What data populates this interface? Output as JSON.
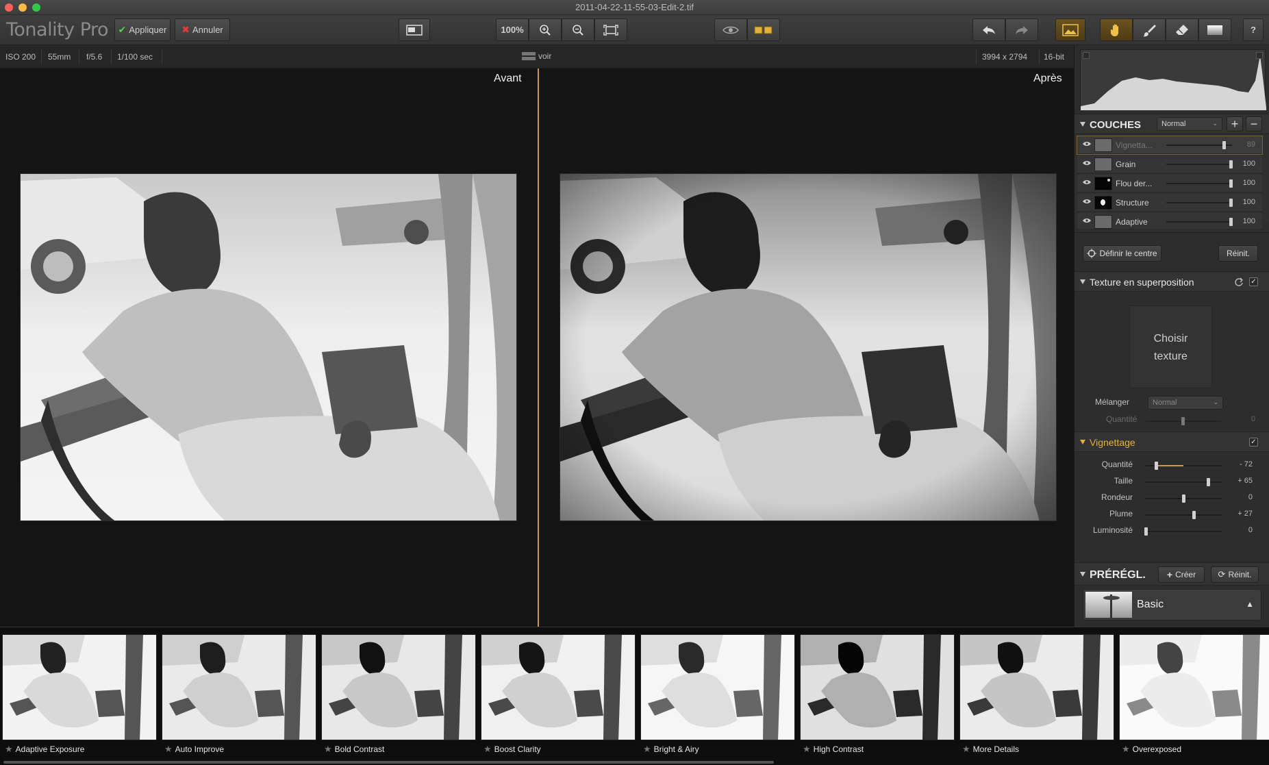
{
  "window": {
    "title": "2011-04-22-11-55-03-Edit-2.tif"
  },
  "toolbar": {
    "app_name": "Tonality Pro",
    "apply_label": "Appliquer",
    "cancel_label": "Annuler",
    "zoom_label": "100%"
  },
  "info": {
    "iso": "ISO 200",
    "focal": "55mm",
    "aperture": "f/5.6",
    "shutter": "1/100 sec",
    "view_label": "voir",
    "dimensions": "3994 x 2794",
    "bitdepth": "16-bit"
  },
  "viewer": {
    "before_label": "Avant",
    "after_label": "Après"
  },
  "layers": {
    "title": "COUCHES",
    "blend_mode": "Normal",
    "items": [
      {
        "name": "Vignetta...",
        "value": 89,
        "value_text": "89"
      },
      {
        "name": "Grain",
        "value": 100,
        "value_text": "100"
      },
      {
        "name": "Flou der...",
        "value": 100,
        "value_text": "100"
      },
      {
        "name": "Structure",
        "value": 100,
        "value_text": "100"
      },
      {
        "name": "Adaptive",
        "value": 100,
        "value_text": "100"
      }
    ]
  },
  "center": {
    "define_label": "Définir le centre",
    "reset_label": "Réinit."
  },
  "texture": {
    "title": "Texture en superposition",
    "choose_line1": "Choisir",
    "choose_line2": "texture",
    "blend_label": "Mélanger",
    "blend_value": "Normal",
    "amount_label": "Quantité",
    "amount_value": "0"
  },
  "vignette": {
    "title": "Vignettage",
    "sliders": [
      {
        "label": "Quantité",
        "value_text": "- 72",
        "value": -72
      },
      {
        "label": "Taille",
        "value_text": "+ 65",
        "value": 65
      },
      {
        "label": "Rondeur",
        "value_text": "0",
        "value": 0
      },
      {
        "label": "Plume",
        "value_text": "+ 27",
        "value": 27
      },
      {
        "label": "Luminosité",
        "value_text": "0",
        "value": 0
      }
    ]
  },
  "presets": {
    "title": "PRÉRÉGL.",
    "create_label": "Créer",
    "reset_label": "Réinit.",
    "category": "Basic",
    "items": [
      "Adaptive Exposure",
      "Auto Improve",
      "Bold Contrast",
      "Boost Clarity",
      "Bright & Airy",
      "High Contrast",
      "More Details",
      "Overexposed"
    ]
  },
  "colors": {
    "accent": "#c99a4b",
    "close": "#fc605b",
    "minimize": "#fdbc40",
    "zoom": "#34c84a"
  }
}
